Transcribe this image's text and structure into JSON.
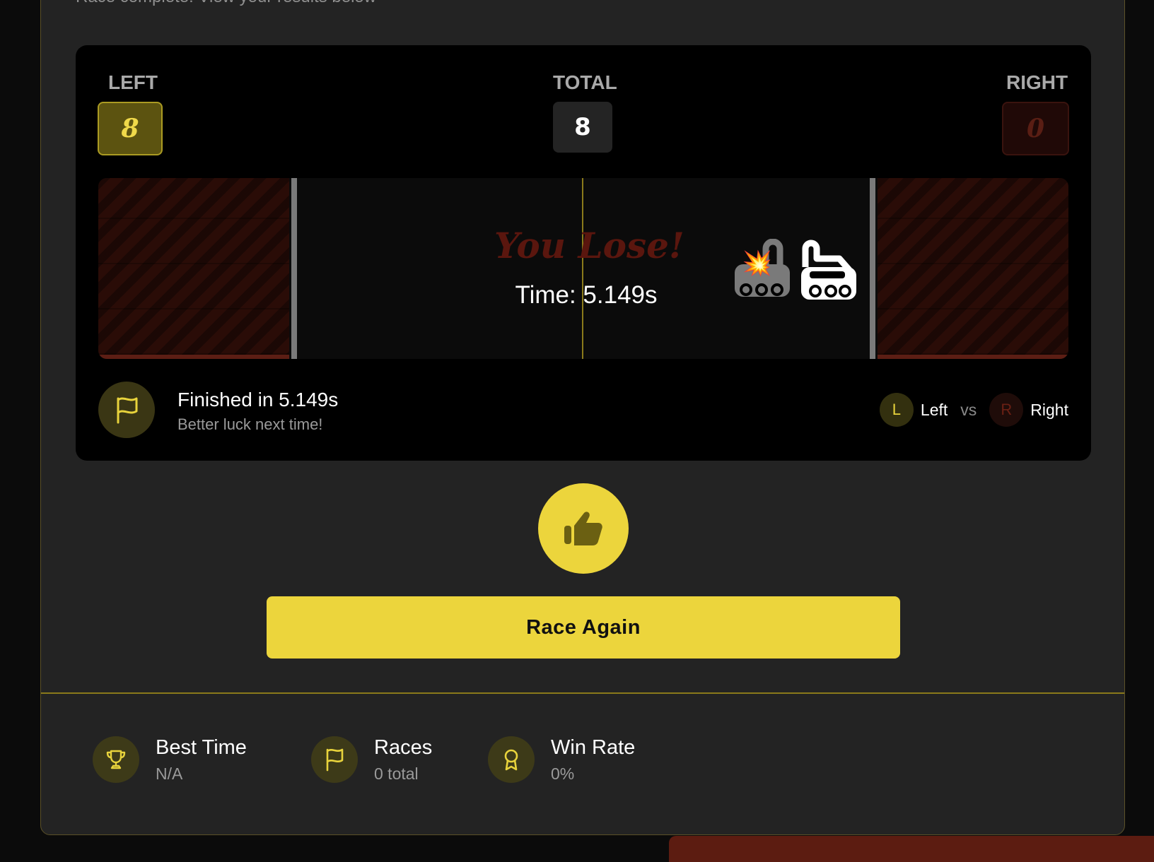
{
  "header": {
    "subtitle": "Race complete! View your results below"
  },
  "scoreboard": {
    "left_label": "LEFT",
    "left_value": "8",
    "total_label": "TOTAL",
    "total_value": "8",
    "right_label": "RIGHT",
    "right_value": "0"
  },
  "track": {
    "result_title": "You Lose!",
    "result_time": "Time: 5.149s",
    "explosion_icon": "💥",
    "cars": [
      "crashed-car-icon",
      "player-car-icon"
    ]
  },
  "finish": {
    "main": "Finished in 5.149s",
    "sub": "Better luck next time!",
    "legend_left_badge": "L",
    "legend_left_label": "Left",
    "legend_vs": "vs",
    "legend_right_badge": "R",
    "legend_right_label": "Right"
  },
  "actions": {
    "thumb_icon": "thumbs-up-icon",
    "race_again": "Race Again"
  },
  "stats": [
    {
      "icon": "trophy-icon",
      "label": "Best Time",
      "value": "N/A"
    },
    {
      "icon": "flag-icon",
      "label": "Races",
      "value": "0 total"
    },
    {
      "icon": "award-icon",
      "label": "Win Rate",
      "value": "0%"
    }
  ],
  "colors": {
    "accent": "#ecd53c",
    "lose": "#5a160e",
    "panel": "#000000",
    "card": "#232323"
  }
}
